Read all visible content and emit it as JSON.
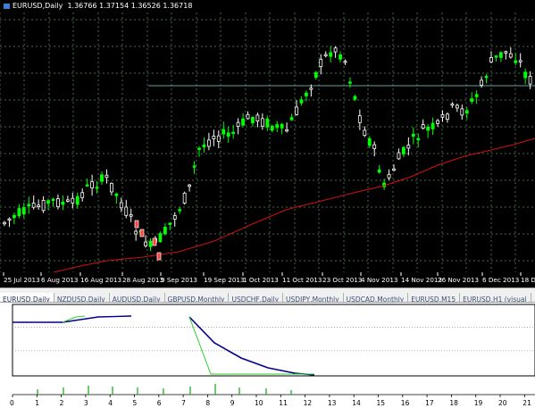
{
  "chart": {
    "symbol": "EURUSD,Daily",
    "ohlc": "1.36766 1.37154 1.36526 1.36718",
    "background": "#000000",
    "grid_color": "#4a6a4a",
    "bull_color": "#00ff00",
    "bear_color": "#ffffff",
    "ma_color": "#d01010",
    "level_color": "#5fa0a0",
    "x_labels": [
      "25 Jul 2013",
      "6 Aug 2013",
      "16 Aug 2013",
      "28 Aug 2013",
      "9 Sep 2013",
      "19 Sep 2013",
      "1 Oct 2013",
      "11 Oct 2013",
      "23 Oct 2013",
      "4 Nov 2013",
      "14 Nov 2013",
      "26 Nov 2013",
      "6 Dec 2013",
      "18 De"
    ]
  },
  "tabs": [
    {
      "label": "EURUSD,Daily",
      "active": true
    },
    {
      "label": "NZDUSD,Daily",
      "active": false
    },
    {
      "label": "AUDUSD,Daily",
      "active": false
    },
    {
      "label": "GBPUSD,Monthly",
      "active": false
    },
    {
      "label": "USDCHF,Daily",
      "active": false
    },
    {
      "label": "USDJPY,Monthly",
      "active": false
    },
    {
      "label": "USDCAD,Monthly",
      "active": false
    },
    {
      "label": "EURUSD,M15",
      "active": false
    },
    {
      "label": "EURUSD,H1 (visual",
      "active": false
    }
  ],
  "tester": {
    "x_ticks": [
      "0",
      "1",
      "2",
      "3",
      "4",
      "5",
      "6",
      "7",
      "8",
      "9",
      "10",
      "11",
      "12",
      "13",
      "14",
      "15",
      "16",
      "17",
      "18",
      "19",
      "20",
      "21"
    ],
    "balance_color": "#00008b",
    "equity_color": "#32cd32"
  }
}
